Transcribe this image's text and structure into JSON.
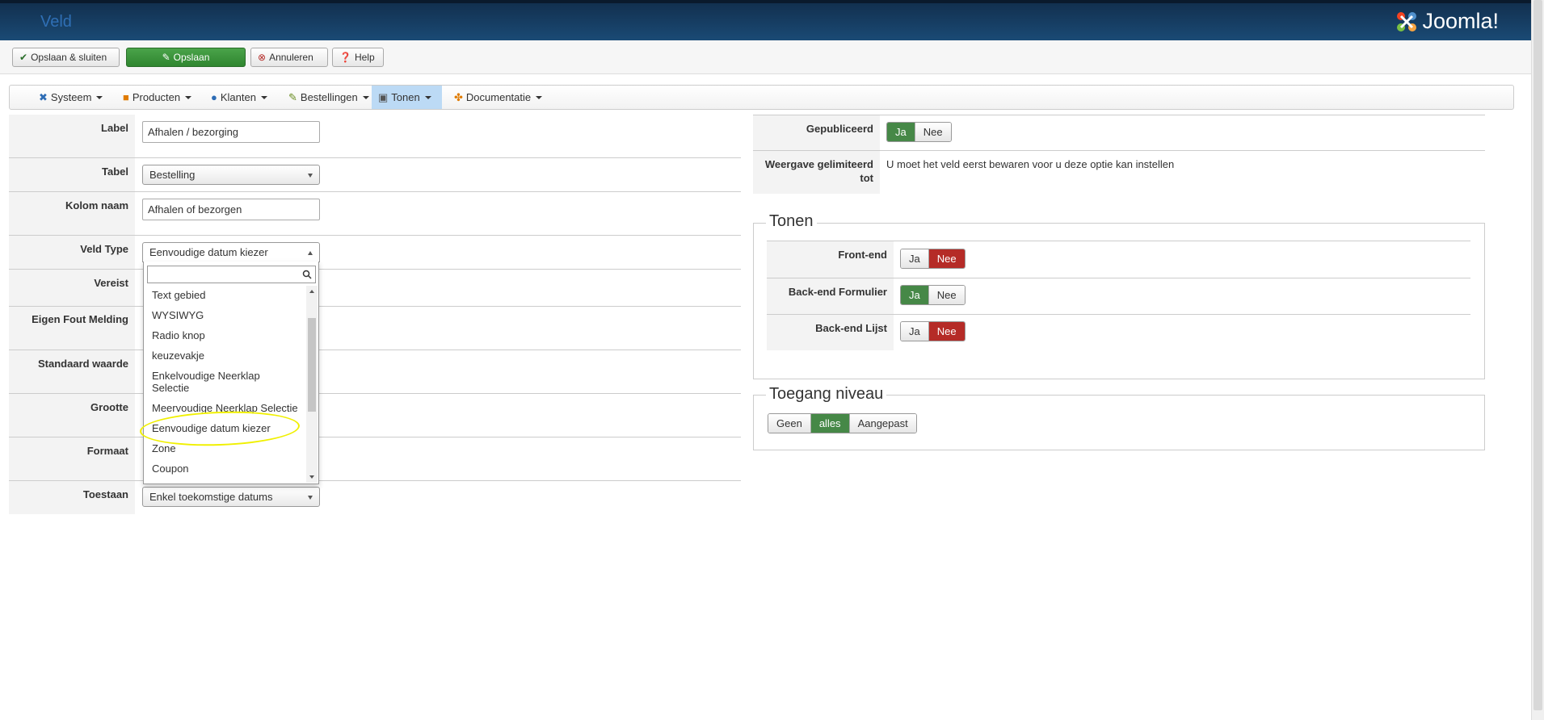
{
  "header": {
    "title": "Veld",
    "brand": "Joomla!"
  },
  "toolbar": {
    "save_close": "Opslaan & sluiten",
    "save": "Opslaan",
    "cancel": "Annuleren",
    "help": "Help"
  },
  "nav": {
    "items": [
      {
        "label": "Systeem",
        "icon": "wrench-icon"
      },
      {
        "label": "Producten",
        "icon": "box-icon"
      },
      {
        "label": "Klanten",
        "icon": "users-icon"
      },
      {
        "label": "Bestellingen",
        "icon": "order-icon"
      },
      {
        "label": "Tonen",
        "icon": "display-icon"
      },
      {
        "label": "Documentatie",
        "icon": "docs-icon"
      }
    ],
    "active": "Tonen"
  },
  "form": {
    "label_label": "Label",
    "label_value": "Afhalen / bezorging",
    "tabel_label": "Tabel",
    "tabel_value": "Bestelling",
    "kolom_label": "Kolom naam",
    "kolom_value": "Afhalen of bezorgen",
    "veldtype_label": "Veld Type",
    "veldtype_value": "Eenvoudige datum kiezer",
    "vereist_label": "Vereist",
    "fout_label": "Eigen Fout Melding",
    "standaard_label": "Standaard waarde",
    "grootte_label": "Grootte",
    "formaat_label": "Formaat",
    "toestaan_label": "Toestaan",
    "toestaan_value": "Enkel toekomstige datums"
  },
  "dropdown": {
    "options": [
      "Text gebied",
      "WYSIWYG",
      "Radio knop",
      "keuzevakje",
      "Enkelvoudige Neerklap Selectie",
      "Meervoudige Neerklap Selectie",
      "Eenvoudige datum kiezer",
      "Zone",
      "Coupon"
    ],
    "highlighted": "Eenvoudige datum kiezer"
  },
  "right": {
    "gepubliceerd_label": "Gepubliceerd",
    "weergave_label": "Weergave gelimiteerd tot",
    "weergave_text": "U moet het veld eerst bewaren voor u deze optie kan instellen",
    "ja": "Ja",
    "nee": "Nee",
    "tonen_title": "Tonen",
    "frontend_label": "Front-end",
    "backend_form_label": "Back-end Formulier",
    "backend_list_label": "Back-end Lijst",
    "toegang_title": "Toegang niveau",
    "toegang_options": [
      "Geen",
      "alles",
      "Aangepast"
    ],
    "toegang_selected": "alles"
  },
  "colors": {
    "active_green": "#468847",
    "active_red": "#b52b27",
    "header_bg": "#1a4a75",
    "highlight": "#f0f000"
  }
}
